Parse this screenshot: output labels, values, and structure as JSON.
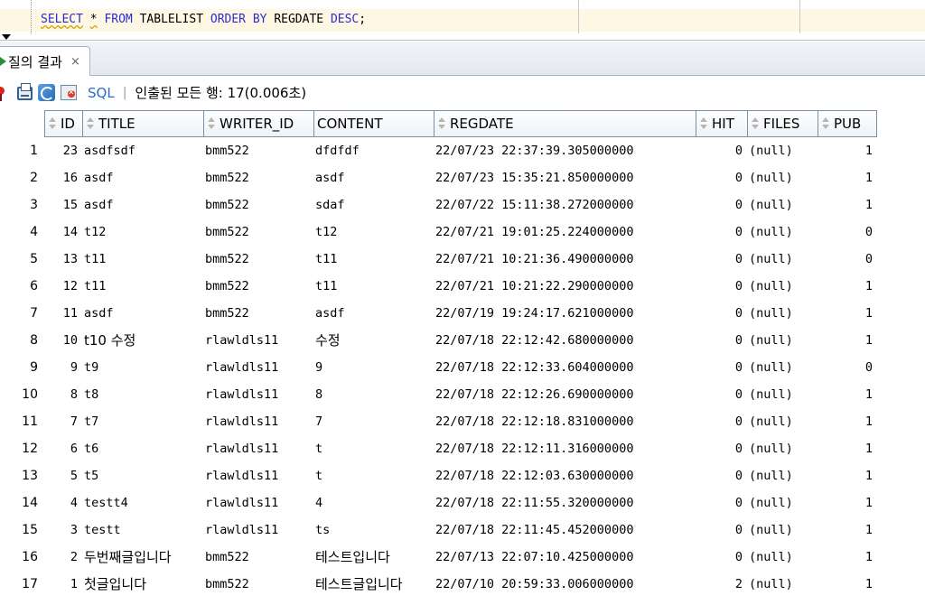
{
  "editor": {
    "keywords1": "SELECT",
    "star": "*",
    "keywords2": "FROM",
    "table": "TABLELIST",
    "keywords3": "ORDER BY",
    "column": "REGDATE",
    "keywords4": "DESC",
    "terminator": ";"
  },
  "tab": {
    "label": "질의 결과",
    "close": "×"
  },
  "toolbar": {
    "sql_label": "SQL",
    "separator": "|",
    "status": "인출된 모든 행: 17(0.006초)"
  },
  "grid": {
    "columns": [
      "ID",
      "TITLE",
      "WRITER_ID",
      "CONTENT",
      "REGDATE",
      "HIT",
      "FILES",
      "PUB"
    ],
    "rows": [
      {
        "n": "1",
        "id": "23",
        "title": "asdfsdf",
        "writer": "bmm522",
        "content": "dfdfdf",
        "regdate": "22/07/23 22:37:39.305000000",
        "hit": "0",
        "files": "(null)",
        "pub": "1"
      },
      {
        "n": "2",
        "id": "16",
        "title": "asdf",
        "writer": "bmm522",
        "content": "asdf",
        "regdate": "22/07/23 15:35:21.850000000",
        "hit": "0",
        "files": "(null)",
        "pub": "1"
      },
      {
        "n": "3",
        "id": "15",
        "title": "asdf",
        "writer": "bmm522",
        "content": "sdaf",
        "regdate": "22/07/22 15:11:38.272000000",
        "hit": "0",
        "files": "(null)",
        "pub": "1"
      },
      {
        "n": "4",
        "id": "14",
        "title": "t12",
        "writer": "bmm522",
        "content": "t12",
        "regdate": "22/07/21 19:01:25.224000000",
        "hit": "0",
        "files": "(null)",
        "pub": "0"
      },
      {
        "n": "5",
        "id": "13",
        "title": "t11",
        "writer": "bmm522",
        "content": "t11",
        "regdate": "22/07/21 10:21:36.490000000",
        "hit": "0",
        "files": "(null)",
        "pub": "0"
      },
      {
        "n": "6",
        "id": "12",
        "title": "t11",
        "writer": "bmm522",
        "content": "t11",
        "regdate": "22/07/21 10:21:22.290000000",
        "hit": "0",
        "files": "(null)",
        "pub": "1"
      },
      {
        "n": "7",
        "id": "11",
        "title": "asdf",
        "writer": "bmm522",
        "content": "asdf",
        "regdate": "22/07/19 19:24:17.621000000",
        "hit": "0",
        "files": "(null)",
        "pub": "1"
      },
      {
        "n": "8",
        "id": "10",
        "title": "t10 수정",
        "writer": "rlawldls11",
        "content": "수정",
        "regdate": "22/07/18 22:12:42.680000000",
        "hit": "0",
        "files": "(null)",
        "pub": "1"
      },
      {
        "n": "9",
        "id": "9",
        "title": "t9",
        "writer": "rlawldls11",
        "content": "9",
        "regdate": "22/07/18 22:12:33.604000000",
        "hit": "0",
        "files": "(null)",
        "pub": "0"
      },
      {
        "n": "10",
        "id": "8",
        "title": "t8",
        "writer": "rlawldls11",
        "content": "8",
        "regdate": "22/07/18 22:12:26.690000000",
        "hit": "0",
        "files": "(null)",
        "pub": "1"
      },
      {
        "n": "11",
        "id": "7",
        "title": "t7",
        "writer": "rlawldls11",
        "content": "7",
        "regdate": "22/07/18 22:12:18.831000000",
        "hit": "0",
        "files": "(null)",
        "pub": "1"
      },
      {
        "n": "12",
        "id": "6",
        "title": "t6",
        "writer": "rlawldls11",
        "content": "t",
        "regdate": "22/07/18 22:12:11.316000000",
        "hit": "0",
        "files": "(null)",
        "pub": "1"
      },
      {
        "n": "13",
        "id": "5",
        "title": "t5",
        "writer": "rlawldls11",
        "content": "t",
        "regdate": "22/07/18 22:12:03.630000000",
        "hit": "0",
        "files": "(null)",
        "pub": "1"
      },
      {
        "n": "14",
        "id": "4",
        "title": "testt4",
        "writer": "rlawldls11",
        "content": "4",
        "regdate": "22/07/18 22:11:55.320000000",
        "hit": "0",
        "files": "(null)",
        "pub": "1"
      },
      {
        "n": "15",
        "id": "3",
        "title": "testt",
        "writer": "rlawldls11",
        "content": "ts",
        "regdate": "22/07/18 22:11:45.452000000",
        "hit": "0",
        "files": "(null)",
        "pub": "1"
      },
      {
        "n": "16",
        "id": "2",
        "title": "두번째글입니다",
        "writer": "bmm522",
        "content": "테스트입니다",
        "regdate": "22/07/13 22:07:10.425000000",
        "hit": "0",
        "files": "(null)",
        "pub": "1"
      },
      {
        "n": "17",
        "id": "1",
        "title": "첫글입니다",
        "writer": "bmm522",
        "content": "테스트글입니다",
        "regdate": "22/07/10 20:59:33.006000000",
        "hit": "2",
        "files": "(null)",
        "pub": "1"
      }
    ]
  },
  "colors": {
    "keyword": "#2b2bd6",
    "line_highlight": "#fdf7e3",
    "sql_link": "#2a6cc8",
    "header_border": "#7d8fa5"
  }
}
